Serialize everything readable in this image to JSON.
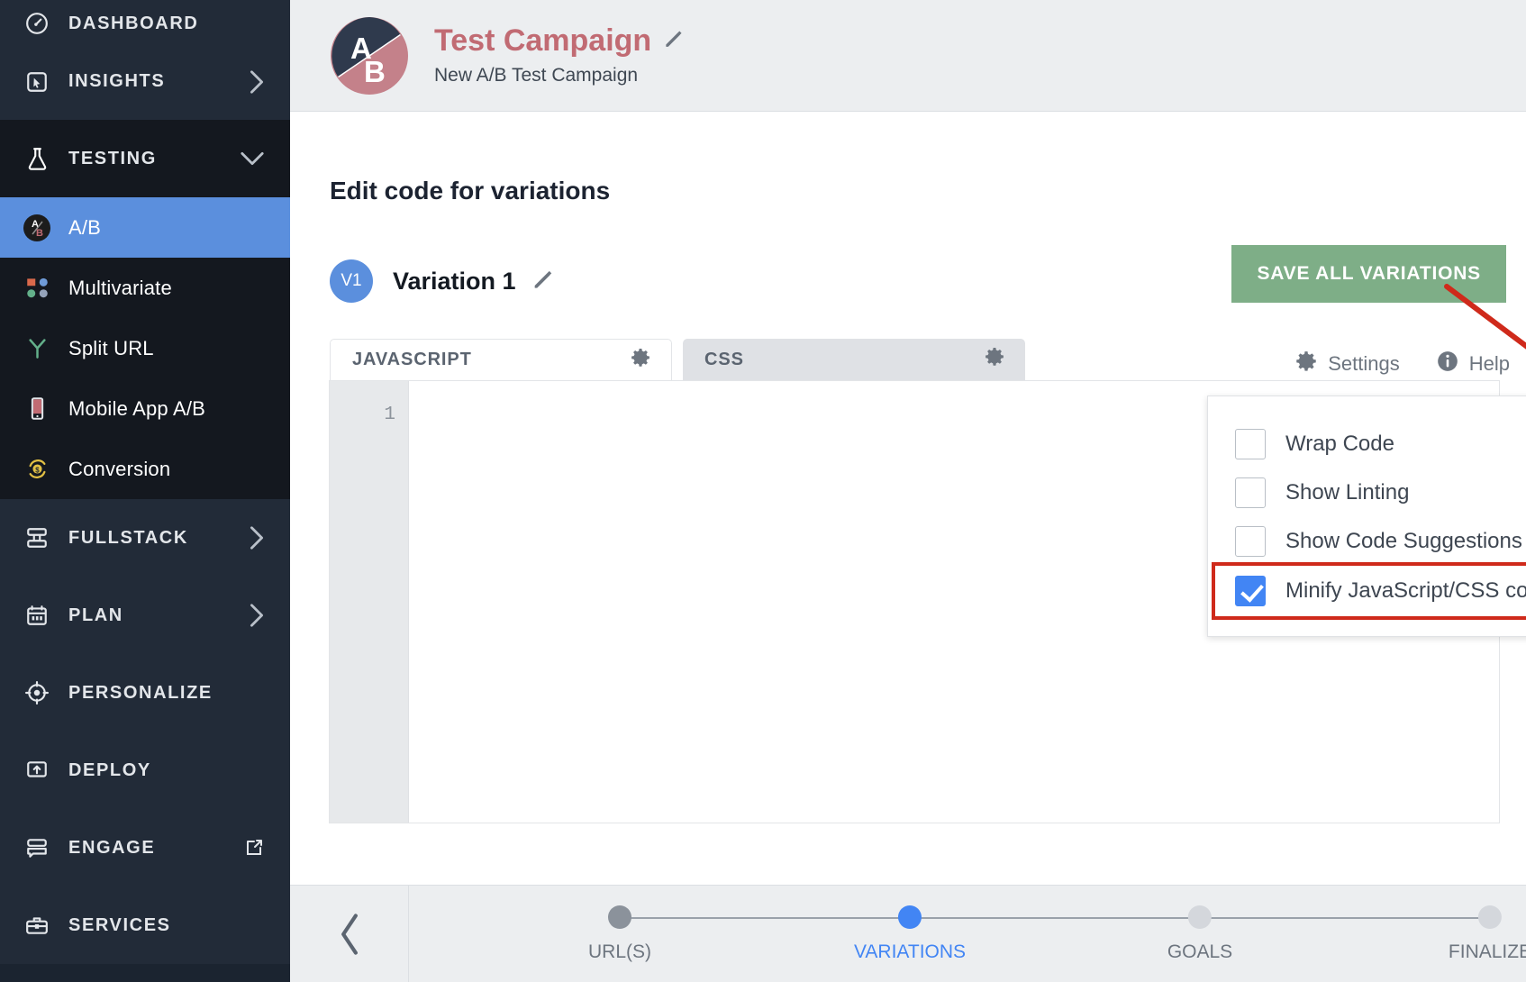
{
  "sidebar": {
    "items": [
      {
        "label": "DASHBOARD",
        "icon": "speedometer-icon",
        "type": "top",
        "chevron": null
      },
      {
        "label": "INSIGHTS",
        "icon": "cursor-box-icon",
        "type": "group",
        "chevron": "›"
      },
      {
        "label": "TESTING",
        "icon": "flask-icon",
        "type": "group-dark",
        "chevron": "⌄"
      }
    ],
    "sub_items": [
      {
        "label": "A/B",
        "icon": "ab-circle-icon",
        "active": true
      },
      {
        "label": "Multivariate",
        "icon": "multivariate-dots-icon",
        "active": false
      },
      {
        "label": "Split URL",
        "icon": "split-url-icon",
        "active": false
      },
      {
        "label": "Mobile App A/B",
        "icon": "mobile-phone-icon",
        "active": false
      },
      {
        "label": "Conversion",
        "icon": "conversion-dollar-icon",
        "active": false
      }
    ],
    "bottom_items": [
      {
        "label": "FULLSTACK",
        "icon": "stack-icon",
        "chevron": "›"
      },
      {
        "label": "PLAN",
        "icon": "calendar-icon",
        "chevron": "›"
      },
      {
        "label": "PERSONALIZE",
        "icon": "target-icon",
        "chevron": null
      },
      {
        "label": "DEPLOY",
        "icon": "deploy-icon",
        "chevron": null
      },
      {
        "label": "ENGAGE",
        "icon": "chat-stack-icon",
        "chevron": "external-link-icon"
      },
      {
        "label": "SERVICES",
        "icon": "toolbox-icon",
        "chevron": null
      }
    ]
  },
  "topbar": {
    "avatar_letters": {
      "a": "A",
      "b": "B"
    },
    "campaign_title": "Test Campaign",
    "campaign_subtitle": "New A/B Test Campaign",
    "edit_icon": "pencil-icon"
  },
  "main": {
    "page_heading": "Edit code for variations",
    "variation": {
      "badge": "V1",
      "name": "Variation 1",
      "edit_icon": "pencil-icon"
    },
    "save_button": "SAVE ALL VARIATIONS",
    "tabs": [
      {
        "label": "JAVASCRIPT",
        "active": true,
        "gear_icon": "gear-icon"
      },
      {
        "label": "CSS",
        "active": false,
        "gear_icon": "gear-icon"
      }
    ],
    "tools": [
      {
        "label": "Settings",
        "icon": "gear-icon"
      },
      {
        "label": "Help",
        "icon": "info-icon"
      }
    ],
    "editor": {
      "line_number": "1",
      "code": ""
    }
  },
  "settings_dropdown": {
    "items": [
      {
        "label": "Wrap Code",
        "checked": false,
        "help": false
      },
      {
        "label": "Show Linting",
        "checked": false,
        "help": false
      },
      {
        "label": "Show Code Suggestions",
        "checked": false,
        "help": false
      },
      {
        "label": "Minify JavaScript/CSS code",
        "checked": true,
        "help": true,
        "help_glyph": "?",
        "highlighted": true
      }
    ]
  },
  "footer": {
    "back_icon": "chevron-left-icon",
    "steps": [
      {
        "label": "URL(S)",
        "state": "done"
      },
      {
        "label": "VARIATIONS",
        "state": "current"
      },
      {
        "label": "GOALS",
        "state": "todo"
      },
      {
        "label": "FINALIZE",
        "state": "todo"
      }
    ]
  },
  "colors": {
    "sidebar_bg": "#1b2430",
    "sidebar_group_bg": "#222b38",
    "accent_blue": "#5b8fdd",
    "save_green": "#7eae87",
    "title_rose": "#c16b73",
    "annotation_red": "#cf2a1b",
    "checkbox_blue": "#4285f4"
  }
}
